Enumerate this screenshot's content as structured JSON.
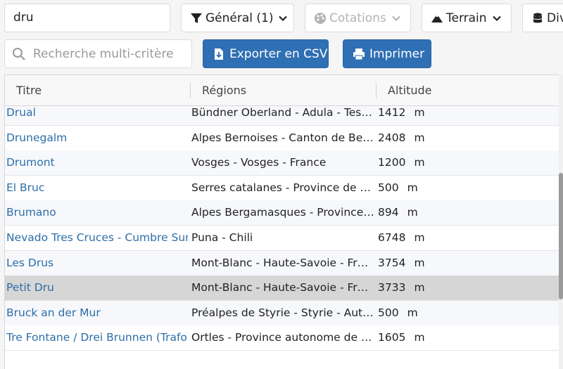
{
  "toolbar": {
    "search_value": "dru",
    "filters": [
      {
        "label": "Général (1)",
        "icon": "funnel-icon",
        "disabled": false
      },
      {
        "label": "Cotations",
        "icon": "palette-icon",
        "disabled": true
      },
      {
        "label": "Terrain",
        "icon": "mountain-icon",
        "disabled": false
      },
      {
        "label": "Div",
        "icon": "database-icon",
        "disabled": false
      }
    ],
    "multi_search_placeholder": "Recherche multi-critère",
    "export_label": "Exporter en CSV",
    "print_label": "Imprimer"
  },
  "table": {
    "columns": [
      "Titre",
      "Régions",
      "Altitude"
    ],
    "rows": [
      {
        "title": "Drual",
        "region": "Bündner Oberland - Adula - Tessin - Suisse",
        "altitude": "1412",
        "unit": "m"
      },
      {
        "title": "Drunegalm",
        "region": "Alpes Bernoises - Canton de Berne - Suisse",
        "altitude": "2408",
        "unit": "m"
      },
      {
        "title": "Drumont",
        "region": "Vosges - Vosges - France",
        "altitude": "1200",
        "unit": "m"
      },
      {
        "title": "El Bruc",
        "region": "Serres catalanes - Province de Barcelone - Espagne",
        "altitude": "500",
        "unit": "m"
      },
      {
        "title": "Brumano",
        "region": "Alpes Bergamasques - Province de Bergame - Italie",
        "altitude": "894",
        "unit": "m"
      },
      {
        "title": "Nevado Tres Cruces - Cumbre Sur",
        "region": "Puna - Chili",
        "altitude": "6748",
        "unit": "m"
      },
      {
        "title": "Les Drus",
        "region": "Mont-Blanc - Haute-Savoie - France",
        "altitude": "3754",
        "unit": "m"
      },
      {
        "title": "Petit Dru",
        "region": "Mont-Blanc - Haute-Savoie - France",
        "altitude": "3733",
        "unit": "m",
        "selected": true
      },
      {
        "title": "Bruck an der Mur",
        "region": "Préalpes de Styrie - Styrie - Autriche",
        "altitude": "500",
        "unit": "m"
      },
      {
        "title": "Tre Fontane / Drei Brunnen (Trafoi)",
        "region": "Ortles - Province autonome de Bolzano - Italie",
        "altitude": "1605",
        "unit": "m"
      }
    ]
  },
  "colors": {
    "link": "#2d6ea8",
    "primary_button": "#2f6fb3",
    "selected_row": "#d6d6d6"
  }
}
